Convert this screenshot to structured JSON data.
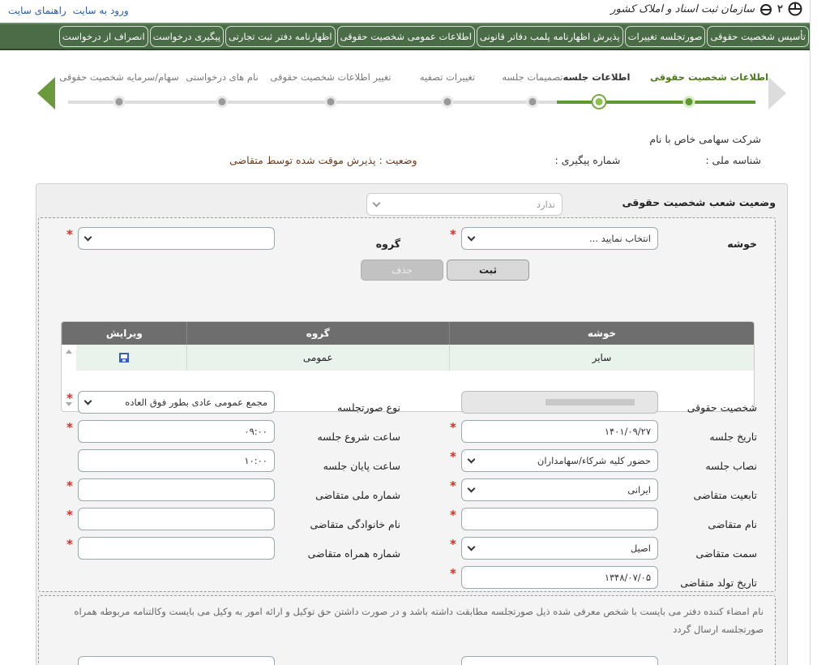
{
  "header": {
    "org_name": "سازمان ثبت اسناد و املاک کشور",
    "links": [
      "ورود به سایت",
      "راهنمای سایت"
    ]
  },
  "nav": {
    "tabs": [
      "تأسیس شخصیت حقوقی",
      "صورتجلسه تغییرات",
      "پذیرش اظهارنامه پلمب دفاتر قانونی",
      "اطلاعات عمومی شخصیت حقوقی",
      "اظهارنامه دفتر ثبت تجارتی",
      "پیگیری درخواست",
      "انصراف از درخواست"
    ]
  },
  "steps": {
    "labels": [
      "اطلاعات شخصیت حقوقی",
      "اطلاعات جلسه",
      "تصمیمات جلسه",
      "تغییرات تصفیه",
      "تغییر اطلاعات شخصیت حقوقی",
      "نام های درخواستی",
      "سهام/سرمایه شخصیت حقوقی"
    ]
  },
  "info": {
    "company_label": "شرکت سهامی خاص با نام",
    "national_id_label": "شناسه ملی :",
    "tracking_label": "شماره پیگیری :",
    "status_label": "وضعیت : پذیرش موقت شده توسط متقاضی"
  },
  "branch_status": {
    "label": "وضعیت شعب شخصیت حقوقی",
    "value": "ندارد"
  },
  "cluster": {
    "cluster_label": "خوشه",
    "cluster_value": "انتخاب نمایید ...",
    "group_label": "گروه",
    "group_value": "",
    "save_label": "ثبت",
    "delete_label": "حذف"
  },
  "table": {
    "headers": [
      "خوشه",
      "گروه",
      "ویرایش"
    ],
    "rows": [
      {
        "cluster": "سایر",
        "group": "عمومی"
      }
    ]
  },
  "form": {
    "legal_entity_label": "شخصیت حقوقی",
    "minutes_type_label": "نوع صورتجلسه",
    "minutes_type_value": "مجمع عمومی عادی بطور فوق العاده",
    "meeting_date_label": "تاریخ جلسه",
    "meeting_date_value": "۱۴۰۱/۰۹/۲۷",
    "start_time_label": "ساعت شروع جلسه",
    "start_time_value": "۰۹:۰۰",
    "quorum_label": "نصاب جلسه",
    "quorum_value": "حضور کلیه شرکاء/سهامداران",
    "end_time_label": "ساعت پایان جلسه",
    "end_time_value": "۱۰:۰۰",
    "nationality_label": "تابعیت متقاضی",
    "nationality_value": "ایرانی",
    "applicant_nid_label": "شماره ملی متقاضی",
    "applicant_name_label": "نام متقاضی",
    "applicant_family_label": "نام خانوادگی متقاضی",
    "applicant_role_label": "سمت متقاضی",
    "applicant_role_value": "اصیل",
    "applicant_mobile_label": "شماره همراه متقاضی",
    "birth_date_label": "تاریخ تولد متقاضی",
    "birth_date_value": "۱۳۴۸/۰۷/۰۵"
  },
  "note": {
    "text": "نام امضاء کننده دفتر می بایست با شخص معرفی شده ذیل صورتجلسه مطابقت داشته باشد و در صورت داشتن حق توکیل و ارائه امور به وکیل می بایست وکالتنامه مربوطه همراه صورتجلسه ارسال گردد"
  }
}
